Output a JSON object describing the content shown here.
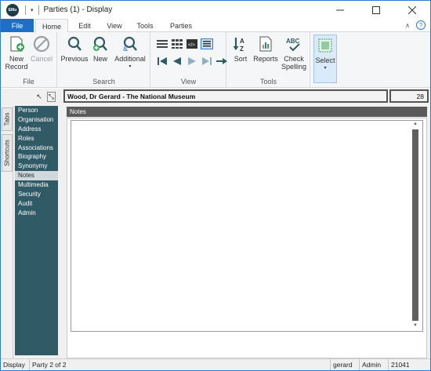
{
  "app": {
    "icon_text": "EMu",
    "title": "Parties (1) - Display"
  },
  "tabs": {
    "file": "File",
    "home": "Home",
    "edit": "Edit",
    "view": "View",
    "tools": "Tools",
    "parties": "Parties"
  },
  "ribbon": {
    "file_group": {
      "label": "File",
      "new_record": "New Record",
      "cancel": "Cancel"
    },
    "search_group": {
      "label": "Search",
      "previous": "Previous",
      "new": "New",
      "additional": "Additional"
    },
    "view_group": {
      "label": "View"
    },
    "tools_group": {
      "label": "Tools",
      "sort": "Sort",
      "reports": "Reports",
      "check_spelling": "Check Spelling"
    },
    "select": {
      "label": "Select"
    }
  },
  "side_tabs": {
    "tabs": "Tabs",
    "shortcuts": "Shortcuts"
  },
  "nav": {
    "items": [
      {
        "label": "Person",
        "selected": false
      },
      {
        "label": "Organisation",
        "selected": false
      },
      {
        "label": "Address",
        "selected": false
      },
      {
        "label": "Roles",
        "selected": false
      },
      {
        "label": "Associations",
        "selected": false
      },
      {
        "label": "Biography",
        "selected": false
      },
      {
        "label": "Synonymy",
        "selected": false
      },
      {
        "label": "Notes",
        "selected": true
      },
      {
        "label": "Multimedia",
        "selected": false
      },
      {
        "label": "Security",
        "selected": false
      },
      {
        "label": "Audit",
        "selected": false
      },
      {
        "label": "Admin",
        "selected": false
      }
    ]
  },
  "record": {
    "header": "Wood, Dr Gerard - The National Museum",
    "number": "28"
  },
  "section": {
    "title": "Notes",
    "notes_value": ""
  },
  "status": {
    "mode": "Display",
    "position": "Party 2 of 2",
    "user": "gerard",
    "group": "Admin",
    "id": "21041"
  },
  "colors": {
    "file_tab": "#1e6fc6",
    "nav_panel": "#2f5a66",
    "nav_selected": "#cfd8dc",
    "section_header": "#5a5a5a"
  }
}
